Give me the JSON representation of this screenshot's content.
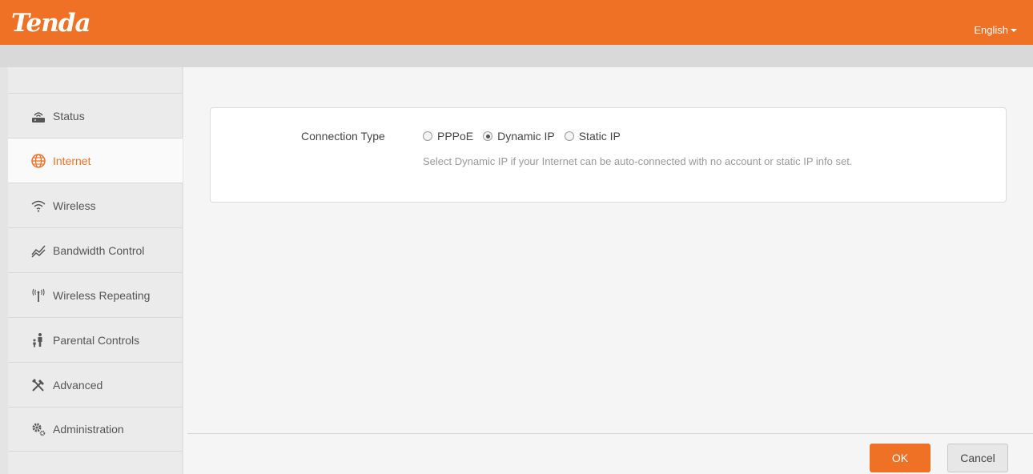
{
  "header": {
    "logo_text": "Tenda",
    "language": "English",
    "brand_color": "#ef7125"
  },
  "sidebar": {
    "items": [
      {
        "label": "Status",
        "icon": "router-icon"
      },
      {
        "label": "Internet",
        "icon": "globe-icon",
        "active": true
      },
      {
        "label": "Wireless",
        "icon": "wifi-icon"
      },
      {
        "label": "Bandwidth Control",
        "icon": "bandwidth-icon"
      },
      {
        "label": "Wireless Repeating",
        "icon": "antenna-icon"
      },
      {
        "label": "Parental Controls",
        "icon": "family-icon"
      },
      {
        "label": "Advanced",
        "icon": "tools-icon"
      },
      {
        "label": "Administration",
        "icon": "gears-icon"
      }
    ]
  },
  "main": {
    "connection_type_label": "Connection Type",
    "options": [
      {
        "label": "PPPoE",
        "checked": false
      },
      {
        "label": "Dynamic IP",
        "checked": true
      },
      {
        "label": "Static IP",
        "checked": false
      }
    ],
    "hint": "Select Dynamic IP if your Internet can be auto-connected with no account or static IP info set."
  },
  "footer": {
    "ok_label": "OK",
    "cancel_label": "Cancel"
  }
}
